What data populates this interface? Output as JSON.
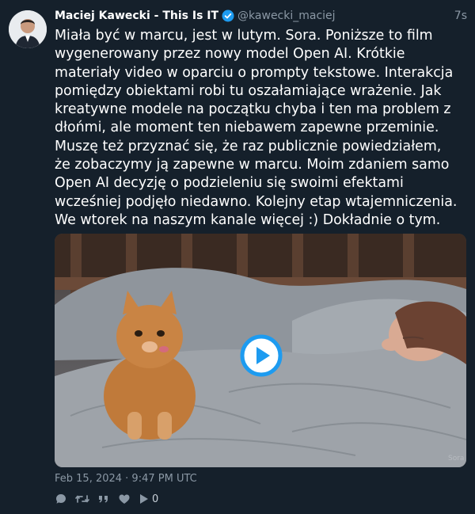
{
  "tweet": {
    "author_name": "Maciej Kawecki - This Is IT",
    "handle": "@kawecki_maciej",
    "relative_time": "7s",
    "text": "Miała być w marcu, jest w lutym. Sora. Poniższe to film wygenerowany przez nowy model Open AI. Krótkie materiały video w oparciu o prompty tekstowe. Interakcja pomiędzy obiektami robi tu oszałamiające wrażenie. Jak kreatywne modele na początku chyba i ten ma problem z dłońmi, ale moment ten niebawem zapewne przeminie. Muszę też przyznać się, że raz publicznie powiedziałem, że zobaczymy ją zapewne w marcu. Moim zdaniem samo Open AI decyzję o podzieleniu się swoimi efektami wcześniej podjęło niedawno. Kolejny etap wtajemniczenia. We wtorek na naszym kanale więcej :) Dokładnie o tym.",
    "date": "Feb 15, 2024 · 9:47 PM UTC",
    "view_count": "0"
  },
  "icons": {
    "verified": "verified-badge-icon",
    "play": "play-icon",
    "reply": "reply-icon",
    "retweet": "retweet-icon",
    "quote": "quote-icon",
    "like": "like-icon",
    "views": "views-icon"
  },
  "colors": {
    "background": "#15202b",
    "text": "#ffffff",
    "muted": "#8b98a5",
    "accent": "#1d9bf0"
  }
}
